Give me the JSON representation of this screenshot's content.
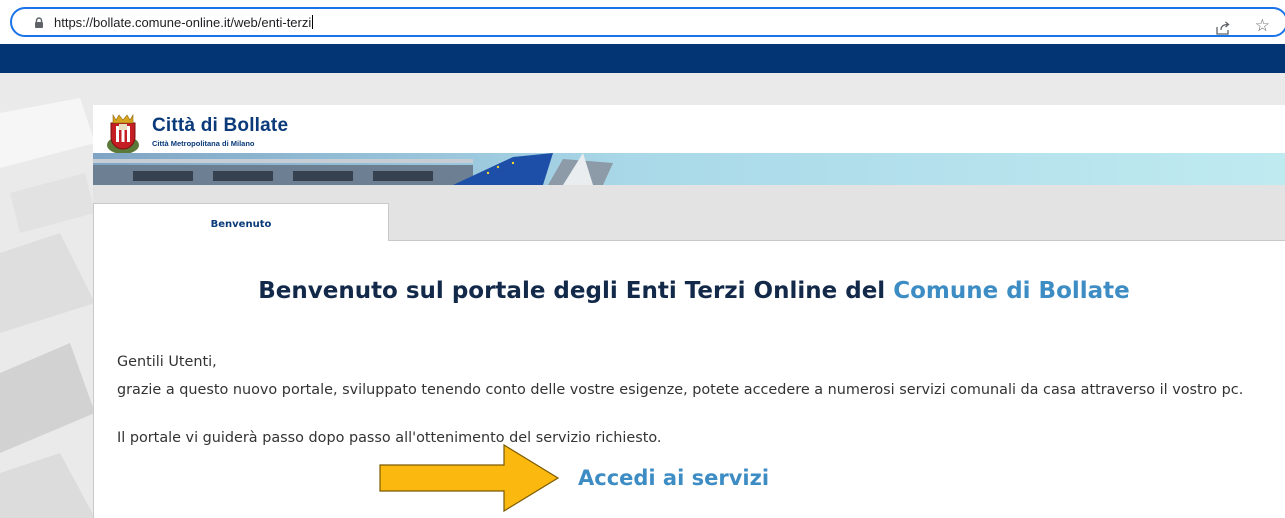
{
  "browser": {
    "url_host": "https://bollate.comune-online.it",
    "url_path": "/web/enti-terzi"
  },
  "header": {
    "title": "Città di Bollate",
    "subtitle": "Città Metropolitana di Milano"
  },
  "tabs": [
    {
      "label": "Benvenuto",
      "active": true
    }
  ],
  "main": {
    "heading_prefix": "Benvenuto sul portale degli Enti Terzi Online del ",
    "heading_accent": "Comune di Bollate",
    "greeting": "Gentili Utenti,",
    "paragraph_1": "grazie a questo nuovo portale, sviluppato tenendo conto delle vostre esigenze, potete accedere a numerosi servizi comunali da casa attraverso il vostro pc.",
    "paragraph_2": "Il portale vi guiderà passo dopo passo all'ottenimento del servizio richiesto.",
    "cta_label": "Accedi ai servizi"
  },
  "icons": {
    "lock": "lock-icon",
    "share": "share-icon",
    "bookmark": "star-icon",
    "crest": "crest-icon",
    "arrow": "arrow-icon"
  },
  "colors": {
    "top_strip": "#033574",
    "brand_blue": "#0a3a7a",
    "accent": "#3d8dc4",
    "heading": "#12294a",
    "arrow_fill": "#fbb80f",
    "arrow_stroke": "#7a5a00",
    "focus_ring": "#1a73e8"
  }
}
